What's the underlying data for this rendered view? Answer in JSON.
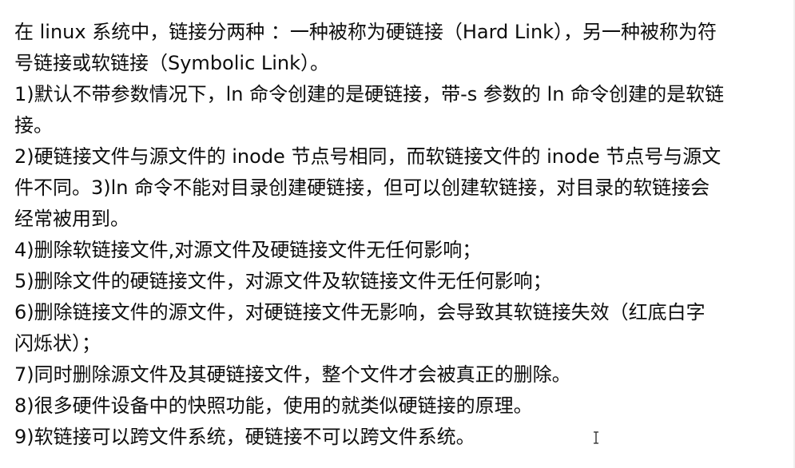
{
  "document": {
    "lines": [
      "在 linux 系统中，链接分两种 ：一种被称为硬链接（Hard Link），另一种被称为符",
      "号链接或软链接（Symbolic Link）。",
      "1)默认不带参数情况下，ln 命令创建的是硬链接，带-s 参数的 ln 命令创建的是软链",
      "接。",
      "2)硬链接文件与源文件的 inode 节点号相同，而软链接文件的 inode 节点号与源文",
      "件不同。3)ln 命令不能对目录创建硬链接，但可以创建软链接，对目录的软链接会",
      "经常被用到。",
      "4)删除软链接文件,对源文件及硬链接文件无任何影响；",
      "5)删除文件的硬链接文件，对源文件及软链接文件无任何影响；",
      "6)删除链接文件的源文件，对硬链接文件无影响，会导致其软链接失效（红底白字",
      "闪烁状）；",
      "7)同时删除源文件及其硬链接文件，整个文件才会被真正的删除。",
      "8)很多硬件设备中的快照功能，使用的就类似硬链接的原理。",
      "9)软链接可以跨文件系统，硬链接不可以跨文件系统。"
    ]
  },
  "cursor_icon": "text-cursor-icon"
}
